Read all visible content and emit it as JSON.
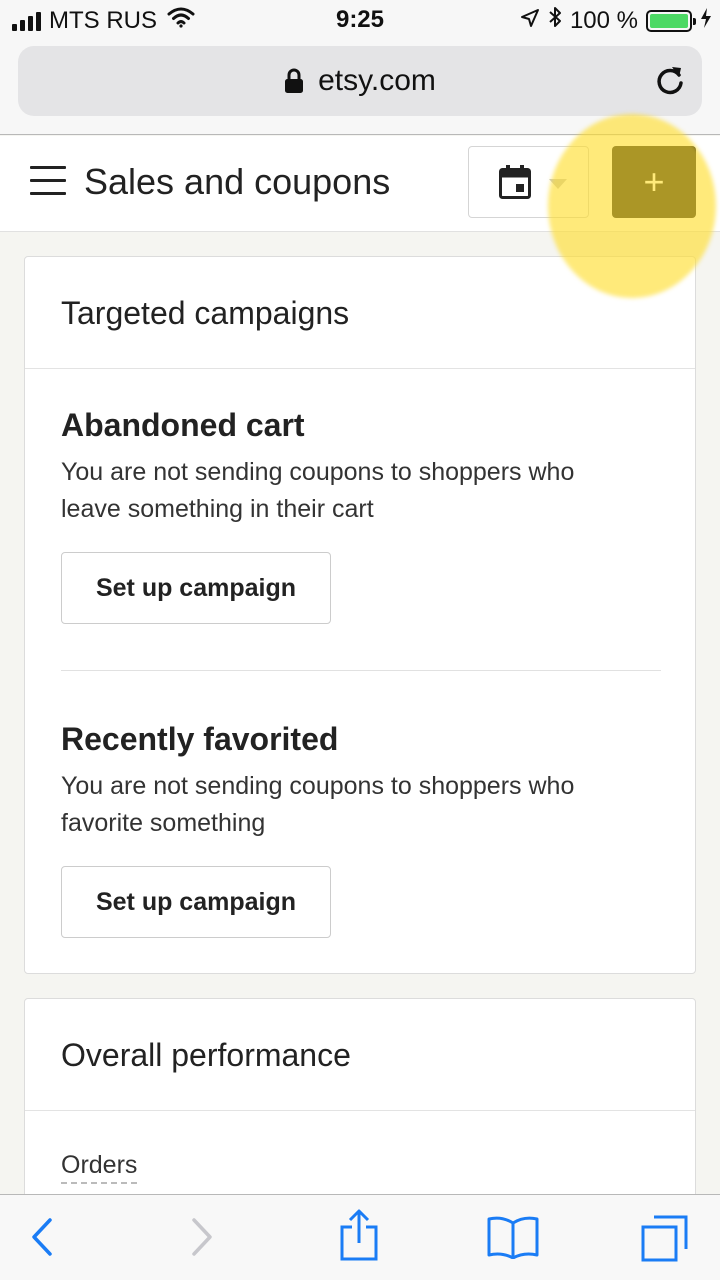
{
  "status_bar": {
    "carrier": "MTS RUS",
    "time": "9:25",
    "battery": "100 %"
  },
  "browser": {
    "url": "etsy.com"
  },
  "header": {
    "title": "Sales and coupons",
    "add_button_label": "+"
  },
  "targeted_campaigns": {
    "title": "Targeted campaigns",
    "sections": [
      {
        "title": "Abandoned cart",
        "description": "You are not sending coupons to shoppers who leave something in their cart",
        "button_label": "Set up campaign"
      },
      {
        "title": "Recently favorited",
        "description": "You are not sending coupons to shoppers who favorite something",
        "button_label": "Set up campaign"
      }
    ]
  },
  "overall_performance": {
    "title": "Overall performance",
    "orders_label": "Orders"
  },
  "colors": {
    "highlight": "#ffdd28",
    "primary_button": "#222222",
    "ios_blue": "#1a7cf5",
    "battery_green": "#4cd964"
  },
  "icons": {
    "menu": "hamburger-icon",
    "calendar": "calendar-icon",
    "lock": "lock-icon",
    "reload": "reload-icon",
    "back": "back-arrow-icon",
    "forward": "forward-arrow-icon",
    "share": "share-icon",
    "bookmarks": "bookmarks-icon",
    "tabs": "tabs-icon"
  }
}
